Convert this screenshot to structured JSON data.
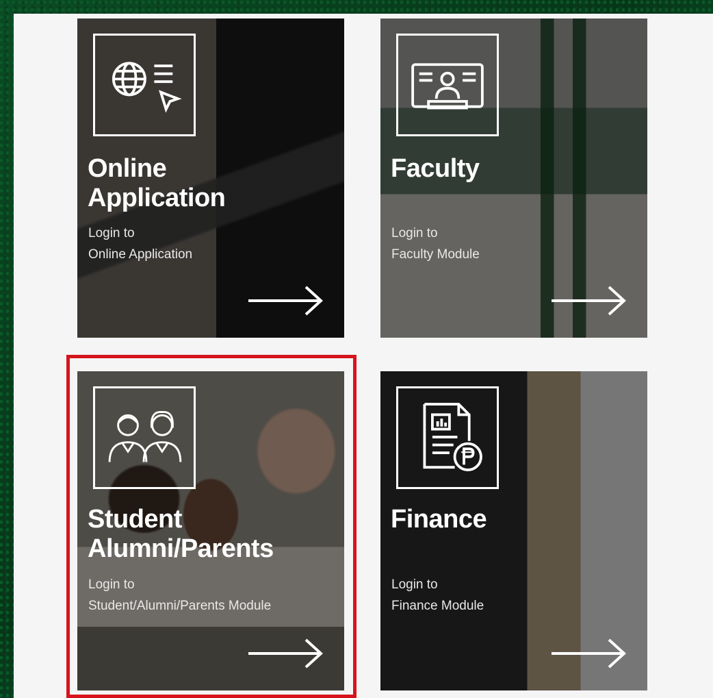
{
  "cards": [
    {
      "id": "online-application",
      "title_line1": "Online",
      "title_line2": "Application",
      "sub_line1": "Login to",
      "sub_line2": "Online Application",
      "icon": "globe-cursor-icon"
    },
    {
      "id": "faculty",
      "title_line1": "Faculty",
      "sub_line1": "Login to",
      "sub_line2": "Faculty Module",
      "icon": "presenter-screen-icon"
    },
    {
      "id": "student-alumni-parents",
      "title_line1": "Student",
      "title_line2": "Alumni/Parents",
      "sub_line1": "Login to",
      "sub_line2": "Student/Alumni/Parents Module",
      "icon": "two-people-icon",
      "highlighted": true
    },
    {
      "id": "finance",
      "title_line1": "Finance",
      "sub_line1": "Login to",
      "sub_line2": "Finance Module",
      "icon": "report-peso-icon"
    }
  ],
  "colors": {
    "highlight": "#d6141c",
    "panel": "#f5f5f5",
    "frame": "#0a4c24",
    "text": "#ffffff"
  }
}
